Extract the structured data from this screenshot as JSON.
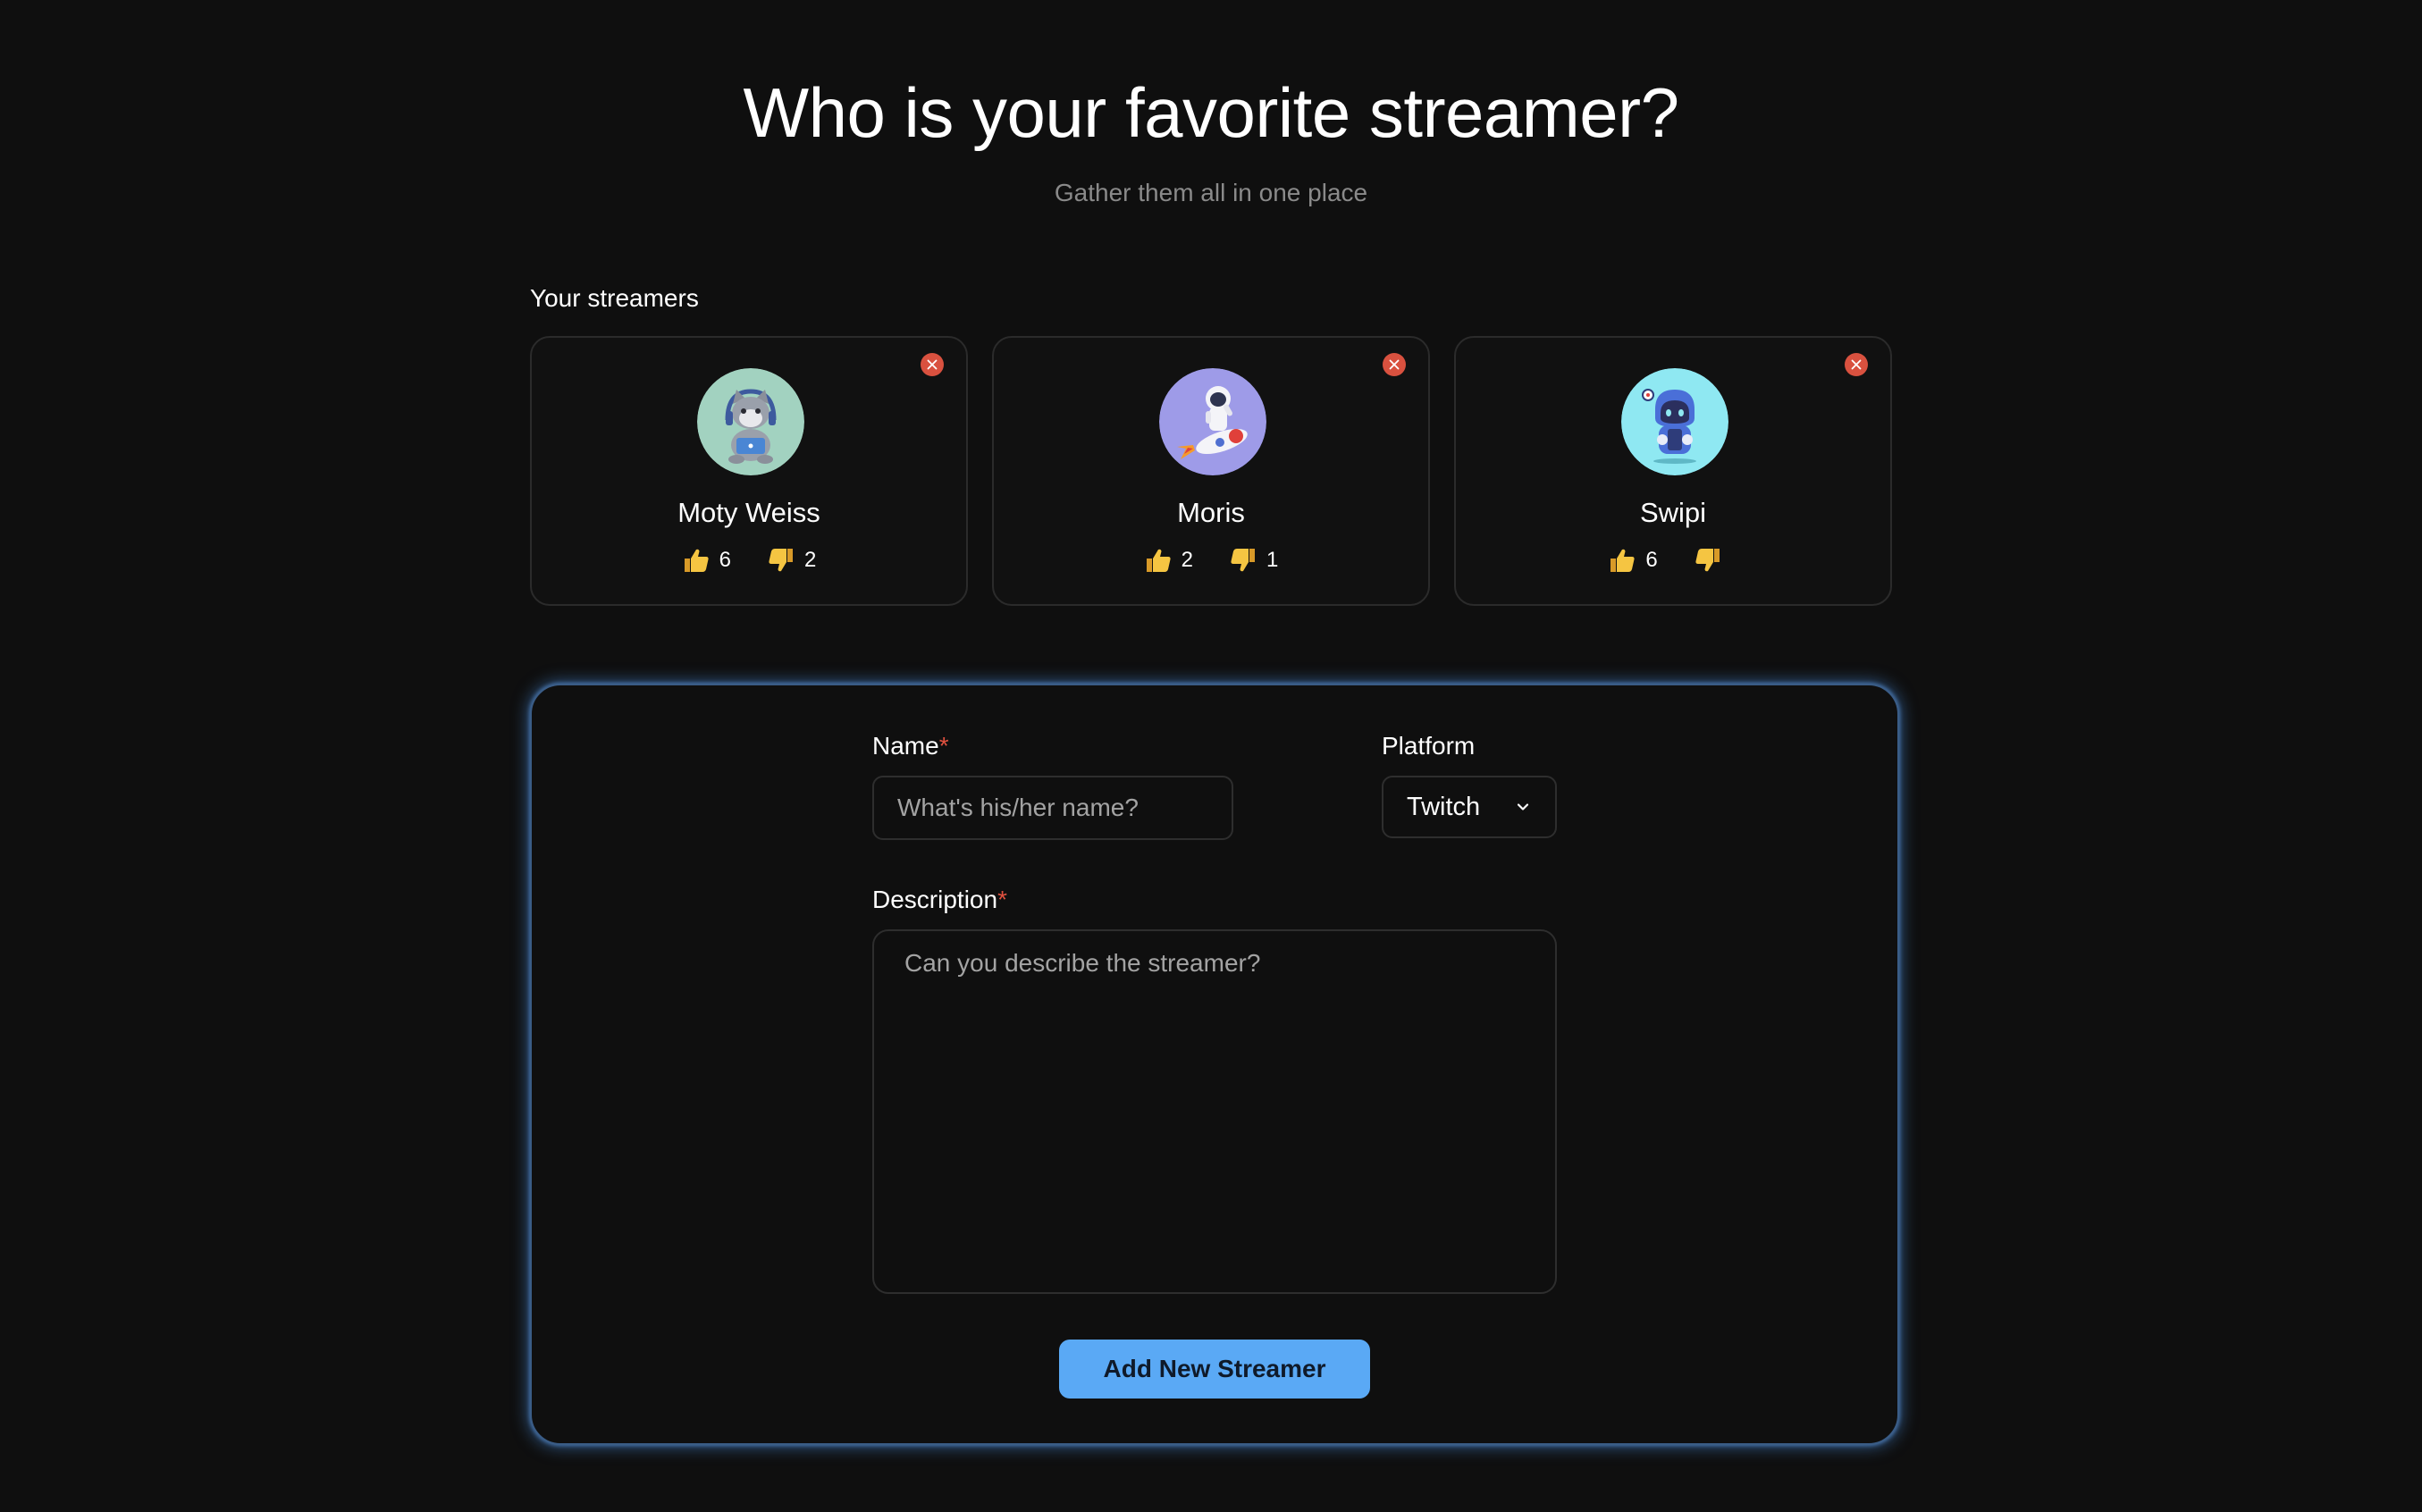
{
  "header": {
    "title": "Who is your favorite streamer?",
    "subtitle": "Gather them all in one place"
  },
  "streamers_section": {
    "label": "Your streamers",
    "streamers": [
      {
        "name": "Moty Weiss",
        "avatar_icon": "cat-with-headphones-icon",
        "avatar_bg": "#a2d2c0",
        "upvotes": "6",
        "downvotes": "2"
      },
      {
        "name": "Moris",
        "avatar_icon": "astronaut-on-rocket-icon",
        "avatar_bg": "#9e9be8",
        "upvotes": "2",
        "downvotes": "1"
      },
      {
        "name": "Swipi",
        "avatar_icon": "robot-with-phone-icon",
        "avatar_bg": "#8fe8f2",
        "upvotes": "6",
        "downvotes": ""
      }
    ]
  },
  "form": {
    "name_label": "Name",
    "name_required_mark": "*",
    "name_placeholder": "What's his/her name?",
    "name_value": "",
    "platform_label": "Platform",
    "platform_selected": "Twitch",
    "description_label": "Description",
    "description_required_mark": "*",
    "description_placeholder": "Can you describe the streamer?",
    "description_value": "",
    "submit_label": "Add New Streamer"
  },
  "colors": {
    "background": "#0f0f0f",
    "accent": "#5aa9f5",
    "remove": "#d9513f",
    "required": "#e0513f",
    "thumb": "#f5c542"
  }
}
